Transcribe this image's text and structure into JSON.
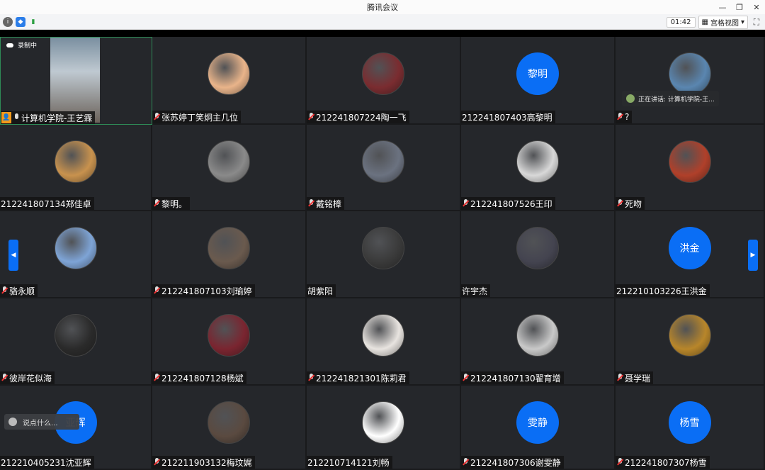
{
  "window": {
    "title": "腾讯会议"
  },
  "toolbar": {
    "timer": "01:42",
    "view_label": "宫格视图"
  },
  "recording_label": "录制中",
  "speaking_label": "正在讲话: 计算机学院-王...",
  "chat_placeholder": "说点什么...",
  "participants": [
    {
      "name": "计算机学院-王艺霖",
      "type": "self"
    },
    {
      "name": "张苏婷丁笑炯主几位",
      "type": "photo",
      "color": "#e9b48a"
    },
    {
      "name": "212241807224陶一飞",
      "type": "photo",
      "color": "#7a2c30"
    },
    {
      "name": "212241807403高黎明",
      "type": "blue",
      "initials": "黎明"
    },
    {
      "name": "?",
      "type": "photo",
      "color": "#5a86b0"
    },
    {
      "name": "212241807134郑佳卓",
      "type": "photo",
      "color": "#c8924e"
    },
    {
      "name": "黎明。",
      "type": "photo",
      "color": "#8a8a8a"
    },
    {
      "name": "戴铭樟",
      "type": "photo",
      "color": "#6b7280"
    },
    {
      "name": "212241807526王印",
      "type": "photo",
      "color": "#d8d8d8"
    },
    {
      "name": "死吻",
      "type": "photo",
      "color": "#b0402a"
    },
    {
      "name": "骆永顺",
      "type": "photo",
      "color": "#7ea4d6"
    },
    {
      "name": "212241807103刘瑜婷",
      "type": "photo",
      "color": "#6a5a4e"
    },
    {
      "name": "胡紫阳",
      "type": "photo",
      "color": "#3a3a3a"
    },
    {
      "name": "许宇杰",
      "type": "photo",
      "color": "#444450"
    },
    {
      "name": "212210103226王洪金",
      "type": "blue",
      "initials": "洪金"
    },
    {
      "name": "彼岸花似海",
      "type": "photo",
      "color": "#2a2a2a"
    },
    {
      "name": "212241807128杨斌",
      "type": "photo",
      "color": "#7a2530"
    },
    {
      "name": "212241821301陈莉君",
      "type": "photo",
      "color": "#e8e4e0"
    },
    {
      "name": "212241807130翟育增",
      "type": "photo",
      "color": "#c9c9c9"
    },
    {
      "name": "聂学瑞",
      "type": "photo",
      "color": "#b8862a"
    },
    {
      "name": "212210405231沈亚辉",
      "type": "blue",
      "initials": "亚辉"
    },
    {
      "name": "212211903132梅玟娓",
      "type": "photo",
      "color": "#5a4a40"
    },
    {
      "name": "212210714121刘畅",
      "type": "photo",
      "color": "#ffffff"
    },
    {
      "name": "212241807306谢雯静",
      "type": "blue",
      "initials": "雯静"
    },
    {
      "name": "212241807307杨雪",
      "type": "blue",
      "initials": "杨雪"
    }
  ],
  "mic_state": [
    true,
    false,
    false,
    null,
    false,
    null,
    false,
    false,
    false,
    false,
    false,
    false,
    null,
    null,
    null,
    false,
    false,
    false,
    false,
    false,
    null,
    false,
    null,
    false,
    false
  ]
}
